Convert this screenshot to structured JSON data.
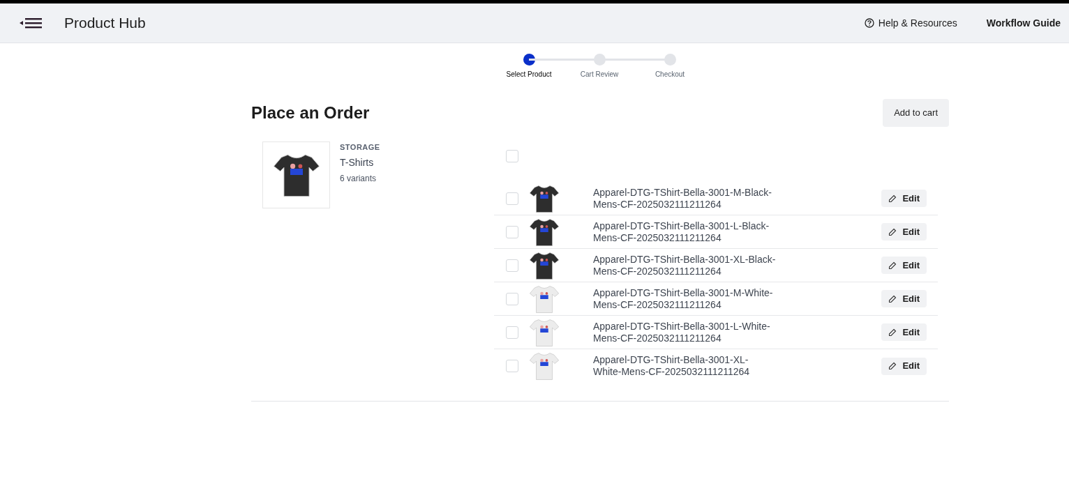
{
  "header": {
    "title": "Product Hub",
    "links": [
      {
        "label": "Help & Resources",
        "kind": "help"
      },
      {
        "label": "Workflow Guide",
        "kind": "plain"
      }
    ]
  },
  "steps": [
    {
      "label": "Select Product",
      "selected": true
    },
    {
      "label": "Cart Review",
      "selected": false
    },
    {
      "label": "Checkout",
      "selected": false
    }
  ],
  "page_title": "Place an Order",
  "add_to_cart": "Add to cart",
  "product": {
    "category": "STORAGE",
    "name": "T-Shirts",
    "variant_count": "6 variants",
    "color": "#2d2d2d"
  },
  "select_all": {
    "checked": false
  },
  "variants": [
    {
      "name": "Apparel-DTG-TShirt-Bella-3001-M-Black-Mens-CF-2025032111211264",
      "checked": false,
      "color": "#2d2d2d",
      "action": "Edit"
    },
    {
      "name": "Apparel-DTG-TShirt-Bella-3001-L-Black-Mens-CF-2025032111211264",
      "checked": false,
      "color": "#2d2d2d",
      "action": "Edit"
    },
    {
      "name": "Apparel-DTG-TShirt-Bella-3001-XL-Black-Mens-CF-2025032111211264",
      "checked": false,
      "color": "#2d2d2d",
      "action": "Edit"
    },
    {
      "name": "Apparel-DTG-TShirt-Bella-3001-M-White-Mens-CF-2025032111211264",
      "checked": false,
      "color": "#ececec",
      "action": "Edit"
    },
    {
      "name": "Apparel-DTG-TShirt-Bella-3001-L-White-Mens-CF-2025032111211264",
      "checked": false,
      "color": "#ececec",
      "action": "Edit"
    },
    {
      "name": "Apparel-DTG-TShirt-Bella-3001-XL-White-Mens-CF-2025032111211264",
      "checked": false,
      "color": "#ececec",
      "action": "Edit"
    }
  ]
}
